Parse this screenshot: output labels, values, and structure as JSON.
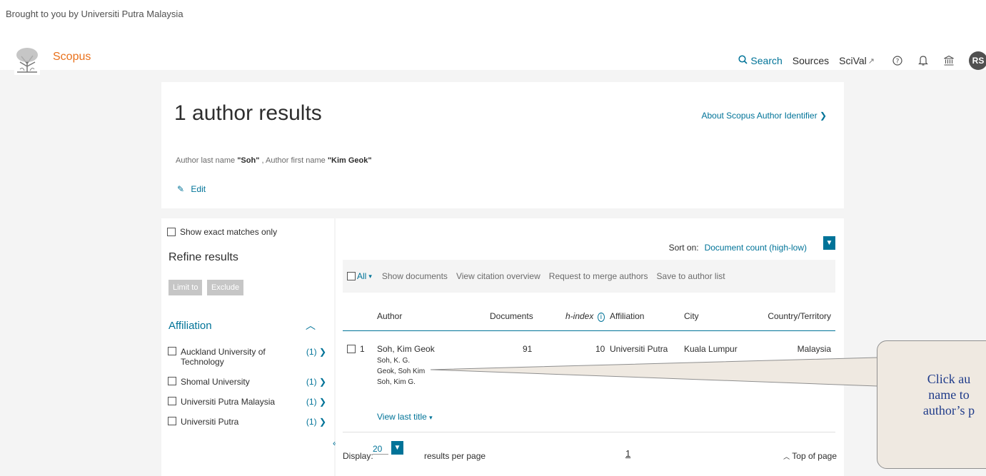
{
  "banner": {
    "text": "Brought to you by Universiti Putra Malaysia"
  },
  "brand": {
    "name": "Scopus",
    "accent": "#e9711c",
    "link_color": "#007398"
  },
  "nav": {
    "search": "Search",
    "sources": "Sources",
    "scival": "SciVal",
    "external_glyph": "↗",
    "avatar": "RS",
    "icons": [
      "help-icon",
      "bell-icon",
      "institution-icon"
    ]
  },
  "header": {
    "title": "1 author results",
    "about_link": "About Scopus Author Identifier",
    "query_prefix": "Author last name ",
    "last_name": "\"Soh\"",
    "query_mid": " , Author first name ",
    "first_name": "\"Kim Geok\"",
    "edit": "Edit"
  },
  "refine": {
    "exact_matches": "Show exact matches only",
    "title": "Refine results",
    "limit_to": "Limit to",
    "exclude": "Exclude",
    "affiliation_title": "Affiliation",
    "affiliations": [
      {
        "name": "Auckland University of Technology",
        "count": "(1)"
      },
      {
        "name": "Shomal University",
        "count": "(1)"
      },
      {
        "name": "Universiti Putra Malaysia",
        "count": "(1)"
      },
      {
        "name": "Universiti Putra",
        "count": "(1)"
      }
    ]
  },
  "results": {
    "sort_label": "Sort on:",
    "sort_value": "Document count (high-low)",
    "actions": {
      "all": "All",
      "show_documents": "Show documents",
      "view_citation": "View citation overview",
      "merge": "Request to merge authors",
      "save": "Save to author list"
    },
    "columns": {
      "author": "Author",
      "documents": "Documents",
      "h_index": "h-index",
      "affiliation": "Affiliation",
      "city": "City",
      "country": "Country/Territory"
    },
    "rows": [
      {
        "num": "1",
        "author": "Soh, Kim Geok",
        "variants": [
          "Soh, K. G.",
          "Geok, Soh Kim",
          "Soh, Kim G."
        ],
        "documents": "91",
        "h_index": "10",
        "affiliation": "Universiti Putra",
        "city": "Kuala Lumpur",
        "country": "Malaysia",
        "last_title": "View last title"
      }
    ],
    "display_label": "Display:",
    "display_value": "20",
    "per_page": "results per page",
    "page": "1",
    "top_of_page": "Top of page"
  },
  "callout": {
    "line1": "Click au",
    "line2": "name to",
    "line3": "author’s p"
  }
}
